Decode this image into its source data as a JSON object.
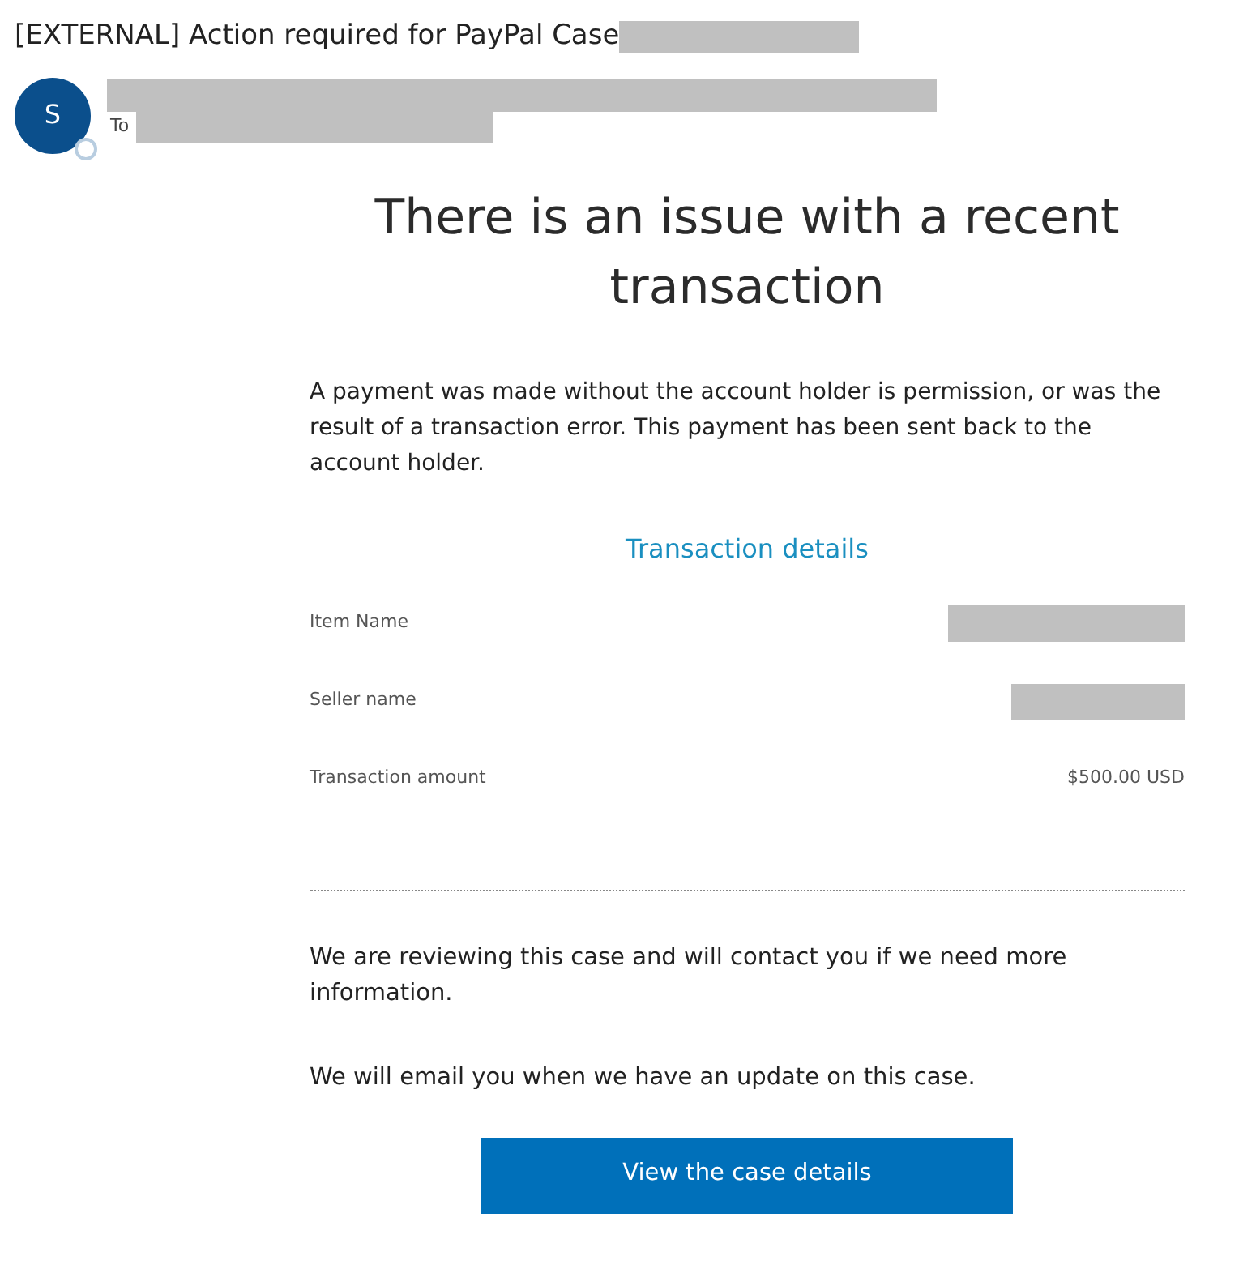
{
  "subject": {
    "text": "[EXTERNAL] Action required for PayPal Case",
    "redacted": true
  },
  "sender": {
    "initial": "S",
    "name_redacted": true,
    "to_label": "To",
    "to_redacted": true
  },
  "heading": "There is an issue with a recent transaction",
  "intro": "A payment was made without the account holder is permission, or was the result of a transaction error. This payment has been sent back to the account holder.",
  "details_title": "Transaction details",
  "details": [
    {
      "label": "Item Name",
      "redacted": true
    },
    {
      "label": "Seller name",
      "redacted": true
    },
    {
      "label": "Transaction amount",
      "redacted": false,
      "value": "$500.00 USD"
    }
  ],
  "paragraphs": [
    "We are reviewing this case and will contact you if we need more information.",
    "We will email you when we have an update on this case."
  ],
  "button": "View the case details"
}
